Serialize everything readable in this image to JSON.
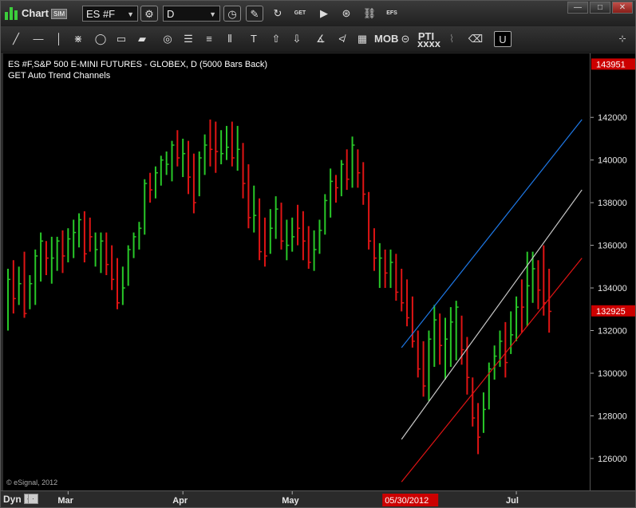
{
  "window": {
    "title": "Chart",
    "sim_badge": "SIM",
    "symbol": "ES #F",
    "interval": "D",
    "toolbar_labels": {
      "get": "GET",
      "efs": "EFS",
      "mob": "MOB",
      "pti": "PTI",
      "pti_sub": "xxxx"
    }
  },
  "header": {
    "line1": "ES #F,S&P 500 E-MINI FUTURES - GLOBEX, D (5000 Bars Back)",
    "line2": "GET Auto Trend Channels"
  },
  "footer": {
    "copyright": "© eSignal, 2012",
    "dyn_label": "Dyn"
  },
  "colors": {
    "up_bar": "#28c828",
    "down_bar": "#e01414",
    "upper_channel": "#1e78e6",
    "middle_channel": "#c8c8c8",
    "lower_channel": "#e01414",
    "price_tag": "#cc0000"
  },
  "chart_data": {
    "type": "ohlc-bar",
    "ylim": [
      124500,
      145000
    ],
    "y_ticks": [
      126000,
      128000,
      130000,
      132000,
      134000,
      136000,
      138000,
      140000,
      142000
    ],
    "y_tick_labels": [
      "126000",
      "128000",
      "130000",
      "132000",
      "134000",
      "136000",
      "138000",
      "140000",
      "142000"
    ],
    "price_tags": [
      {
        "label": "143951",
        "value": 144500
      },
      {
        "label": "132925",
        "value": 132925
      }
    ],
    "x_labels": [
      {
        "label": "Mar",
        "bar": 11
      },
      {
        "label": "Apr",
        "bar": 32
      },
      {
        "label": "May",
        "bar": 52
      },
      {
        "label": "05/30/2012",
        "bar": 72,
        "highlight": true
      },
      {
        "label": "Jul",
        "bar": 93
      }
    ],
    "bar_count": 100,
    "bars": [
      {
        "h": 134900,
        "l": 132000,
        "c": 134400,
        "up": true
      },
      {
        "h": 135300,
        "l": 132800,
        "c": 133500,
        "up": false
      },
      {
        "h": 135000,
        "l": 133200,
        "c": 134200,
        "up": true
      },
      {
        "h": 135700,
        "l": 132600,
        "c": 132800,
        "up": false
      },
      {
        "h": 134600,
        "l": 133000,
        "c": 134200,
        "up": true
      },
      {
        "h": 135800,
        "l": 133200,
        "c": 135500,
        "up": true
      },
      {
        "h": 136600,
        "l": 134300,
        "c": 136200,
        "up": true
      },
      {
        "h": 136200,
        "l": 134600,
        "c": 135400,
        "up": false
      },
      {
        "h": 136400,
        "l": 134200,
        "c": 135400,
        "up": true
      },
      {
        "h": 136400,
        "l": 134800,
        "c": 136200,
        "up": true
      },
      {
        "h": 136700,
        "l": 134700,
        "c": 135500,
        "up": false
      },
      {
        "h": 136800,
        "l": 135200,
        "c": 136300,
        "up": true
      },
      {
        "h": 137200,
        "l": 135400,
        "c": 136600,
        "up": true
      },
      {
        "h": 137500,
        "l": 135900,
        "c": 137200,
        "up": true
      },
      {
        "h": 137600,
        "l": 135200,
        "c": 135600,
        "up": false
      },
      {
        "h": 137300,
        "l": 135700,
        "c": 136400,
        "up": false
      },
      {
        "h": 136600,
        "l": 135000,
        "c": 135800,
        "up": true
      },
      {
        "h": 136600,
        "l": 134700,
        "c": 136200,
        "up": true
      },
      {
        "h": 136600,
        "l": 134600,
        "c": 135100,
        "up": false
      },
      {
        "h": 136000,
        "l": 133900,
        "c": 134400,
        "up": false
      },
      {
        "h": 135400,
        "l": 133000,
        "c": 133300,
        "up": false
      },
      {
        "h": 135000,
        "l": 133200,
        "c": 134000,
        "up": true
      },
      {
        "h": 136000,
        "l": 134100,
        "c": 135800,
        "up": true
      },
      {
        "h": 136600,
        "l": 135400,
        "c": 136400,
        "up": true
      },
      {
        "h": 137100,
        "l": 135800,
        "c": 136800,
        "up": true
      },
      {
        "h": 139100,
        "l": 136500,
        "c": 138900,
        "up": true
      },
      {
        "h": 139400,
        "l": 138000,
        "c": 138600,
        "up": false
      },
      {
        "h": 139700,
        "l": 138200,
        "c": 139400,
        "up": true
      },
      {
        "h": 140200,
        "l": 138800,
        "c": 140000,
        "up": true
      },
      {
        "h": 140400,
        "l": 139300,
        "c": 139800,
        "up": true
      },
      {
        "h": 140900,
        "l": 139000,
        "c": 140700,
        "up": true
      },
      {
        "h": 141400,
        "l": 139700,
        "c": 140100,
        "up": false
      },
      {
        "h": 141000,
        "l": 139200,
        "c": 140300,
        "up": true
      },
      {
        "h": 140900,
        "l": 138400,
        "c": 139200,
        "up": false
      },
      {
        "h": 140300,
        "l": 137500,
        "c": 138000,
        "up": false
      },
      {
        "h": 140400,
        "l": 138300,
        "c": 140100,
        "up": true
      },
      {
        "h": 141200,
        "l": 139300,
        "c": 140700,
        "up": true
      },
      {
        "h": 141900,
        "l": 139700,
        "c": 140500,
        "up": false
      },
      {
        "h": 141800,
        "l": 139400,
        "c": 140400,
        "up": false
      },
      {
        "h": 141400,
        "l": 139800,
        "c": 140300,
        "up": true
      },
      {
        "h": 141600,
        "l": 140000,
        "c": 140600,
        "up": true
      },
      {
        "h": 141800,
        "l": 139700,
        "c": 140100,
        "up": false
      },
      {
        "h": 141600,
        "l": 139500,
        "c": 140500,
        "up": true
      },
      {
        "h": 140800,
        "l": 138200,
        "c": 138900,
        "up": false
      },
      {
        "h": 139800,
        "l": 136800,
        "c": 137300,
        "up": false
      },
      {
        "h": 138800,
        "l": 136600,
        "c": 137400,
        "up": true
      },
      {
        "h": 138200,
        "l": 135300,
        "c": 135700,
        "up": false
      },
      {
        "h": 137300,
        "l": 135000,
        "c": 135500,
        "up": false
      },
      {
        "h": 137700,
        "l": 135600,
        "c": 136800,
        "up": true
      },
      {
        "h": 138300,
        "l": 136300,
        "c": 137700,
        "up": true
      },
      {
        "h": 138000,
        "l": 135800,
        "c": 136200,
        "up": false
      },
      {
        "h": 137200,
        "l": 135300,
        "c": 136000,
        "up": true
      },
      {
        "h": 137300,
        "l": 135700,
        "c": 136400,
        "up": true
      },
      {
        "h": 137900,
        "l": 136000,
        "c": 136800,
        "up": false
      },
      {
        "h": 137600,
        "l": 135300,
        "c": 136200,
        "up": false
      },
      {
        "h": 136900,
        "l": 134900,
        "c": 135200,
        "up": false
      },
      {
        "h": 136700,
        "l": 134800,
        "c": 135800,
        "up": true
      },
      {
        "h": 137200,
        "l": 135600,
        "c": 136700,
        "up": true
      },
      {
        "h": 138400,
        "l": 136500,
        "c": 138100,
        "up": true
      },
      {
        "h": 139600,
        "l": 137300,
        "c": 139000,
        "up": true
      },
      {
        "h": 139300,
        "l": 138000,
        "c": 138700,
        "up": false
      },
      {
        "h": 140000,
        "l": 138300,
        "c": 139800,
        "up": true
      },
      {
        "h": 140500,
        "l": 138600,
        "c": 139100,
        "up": false
      },
      {
        "h": 141100,
        "l": 138700,
        "c": 140700,
        "up": true
      },
      {
        "h": 140500,
        "l": 138700,
        "c": 139400,
        "up": false
      },
      {
        "h": 139900,
        "l": 137900,
        "c": 138400,
        "up": false
      },
      {
        "h": 138500,
        "l": 135800,
        "c": 136200,
        "up": false
      },
      {
        "h": 136800,
        "l": 134800,
        "c": 135400,
        "up": false
      },
      {
        "h": 136100,
        "l": 134000,
        "c": 135400,
        "up": true
      },
      {
        "h": 135800,
        "l": 134000,
        "c": 134700,
        "up": false
      },
      {
        "h": 135800,
        "l": 134000,
        "c": 135200,
        "up": true
      },
      {
        "h": 135600,
        "l": 133400,
        "c": 133800,
        "up": false
      },
      {
        "h": 134900,
        "l": 132900,
        "c": 133300,
        "up": false
      },
      {
        "h": 134400,
        "l": 132200,
        "c": 132600,
        "up": false
      },
      {
        "h": 133600,
        "l": 131200,
        "c": 131500,
        "up": false
      },
      {
        "h": 132000,
        "l": 129800,
        "c": 130200,
        "up": false
      },
      {
        "h": 131500,
        "l": 128900,
        "c": 129400,
        "up": false
      },
      {
        "h": 132000,
        "l": 128700,
        "c": 131600,
        "up": true
      },
      {
        "h": 133200,
        "l": 130300,
        "c": 132500,
        "up": true
      },
      {
        "h": 132800,
        "l": 130400,
        "c": 131300,
        "up": false
      },
      {
        "h": 132600,
        "l": 129700,
        "c": 131600,
        "up": true
      },
      {
        "h": 133100,
        "l": 130300,
        "c": 132400,
        "up": true
      },
      {
        "h": 133400,
        "l": 130600,
        "c": 133100,
        "up": true
      },
      {
        "h": 132700,
        "l": 130400,
        "c": 131100,
        "up": false
      },
      {
        "h": 131700,
        "l": 129000,
        "c": 129800,
        "up": false
      },
      {
        "h": 129800,
        "l": 127500,
        "c": 127900,
        "up": false
      },
      {
        "h": 128600,
        "l": 126200,
        "c": 127000,
        "up": false
      },
      {
        "h": 129100,
        "l": 127200,
        "c": 128300,
        "up": true
      },
      {
        "h": 130500,
        "l": 128300,
        "c": 130200,
        "up": true
      },
      {
        "h": 131300,
        "l": 129700,
        "c": 130800,
        "up": true
      },
      {
        "h": 132000,
        "l": 130300,
        "c": 131500,
        "up": true
      },
      {
        "h": 132400,
        "l": 129800,
        "c": 130500,
        "up": false
      },
      {
        "h": 132900,
        "l": 130900,
        "c": 131800,
        "up": true
      },
      {
        "h": 133600,
        "l": 131500,
        "c": 133100,
        "up": true
      },
      {
        "h": 134400,
        "l": 131900,
        "c": 133100,
        "up": false
      },
      {
        "h": 135700,
        "l": 132200,
        "c": 134100,
        "up": true
      },
      {
        "h": 135700,
        "l": 133300,
        "c": 134900,
        "up": true
      },
      {
        "h": 135300,
        "l": 133000,
        "c": 133900,
        "up": false
      },
      {
        "h": 136000,
        "l": 132700,
        "c": 133300,
        "up": false
      },
      {
        "h": 134900,
        "l": 131900,
        "c": 132900,
        "up": false
      }
    ],
    "channels": [
      {
        "name": "upper",
        "from": [
          72,
          131200
        ],
        "to": [
          105,
          141900
        ]
      },
      {
        "name": "middle",
        "from": [
          72,
          126900
        ],
        "to": [
          105,
          138600
        ]
      },
      {
        "name": "lower",
        "from": [
          72,
          124900
        ],
        "to": [
          105,
          135400
        ]
      }
    ]
  }
}
